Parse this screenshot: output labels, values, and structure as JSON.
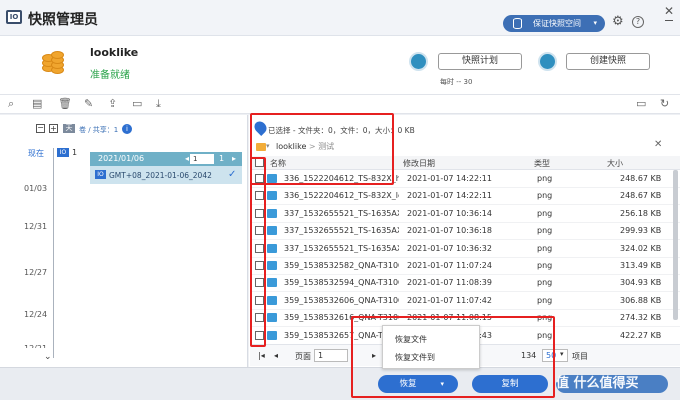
{
  "app": {
    "title": "快照管理员",
    "logo_text": "IO"
  },
  "header": {
    "space_button": "保证快照空间",
    "volume_name": "looklike",
    "volume_status": "准备就绪",
    "schedule_button": "快照计划",
    "schedule_info": "每时 -- 30",
    "create_button": "创建快照"
  },
  "left": {
    "tree_toggle": "天",
    "tree_label": "卷 / 共享：1",
    "now_label": "现在",
    "now_badge": "IO",
    "now_count": "1",
    "date_group": "2021/01/06",
    "page_current": "1",
    "page_total": "1",
    "snapshot_name": "GMT+08_2021-01-06_2042",
    "timeline": [
      "01/03",
      "12/31",
      "12/27",
      "12/24",
      "12/21"
    ]
  },
  "right": {
    "selection_info": "已选择 - 文件夹：0，文件：0，大小：0 KB",
    "crumb_root": "looklike",
    "crumb_sub": "测试",
    "columns": {
      "name": "名称",
      "date": "修改日期",
      "type": "类型",
      "size": "大小"
    },
    "rows": [
      {
        "name": "336_1522204612_TS-832X_high...",
        "date": "2021-01-07 14:22:11",
        "type": "png",
        "size": "248.67 KB"
      },
      {
        "name": "336_1522204612_TS-832X_left-...",
        "date": "2021-01-07 14:22:11",
        "type": "png",
        "size": "248.67 KB"
      },
      {
        "name": "337_1532655521_TS-1635AX_Fr...",
        "date": "2021-01-07 10:36:14",
        "type": "png",
        "size": "256.18 KB"
      },
      {
        "name": "337_1532655521_TS-1635AX_H...",
        "date": "2021-01-07 10:36:18",
        "type": "png",
        "size": "299.93 KB"
      },
      {
        "name": "337_1532655521_TS-1635AX_Ri...",
        "date": "2021-01-07 10:36:32",
        "type": "png",
        "size": "324.02 KB"
      },
      {
        "name": "359_1538532582_QNA-T310G1T...",
        "date": "2021-01-07 11:07:24",
        "type": "png",
        "size": "313.49 KB"
      },
      {
        "name": "359_1538532594_QNA-T310G1S...",
        "date": "2021-01-07 11:08:39",
        "type": "png",
        "size": "304.93 KB"
      },
      {
        "name": "359_1538532606_QNA-T310G1T...",
        "date": "2021-01-07 11:07:42",
        "type": "png",
        "size": "306.88 KB"
      },
      {
        "name": "359_1538532616_QNA-T310G1S...",
        "date": "2021-01-07 11:08:15",
        "type": "png",
        "size": "274.32 KB"
      },
      {
        "name": "359_1538532657_QNA-T310G1T...",
        "date": "2021-01-07 11:07:43",
        "type": "png",
        "size": "422.27 KB"
      }
    ],
    "pager": {
      "page_label": "页面",
      "page_value": "1",
      "total": "134",
      "per_page_label": "显示",
      "per_page": "50",
      "items_label": "项目"
    }
  },
  "context_menu": {
    "items": [
      "恢复文件",
      "恢复文件到"
    ]
  },
  "footer": {
    "restore_button": "恢复",
    "copy_button": "复制"
  },
  "watermark": "值 什么值得买",
  "colors": {
    "accent": "#2d6fd0",
    "status_green": "#2aa34a",
    "annotation_red": "#e62020",
    "folder": "#f2ad3a"
  }
}
